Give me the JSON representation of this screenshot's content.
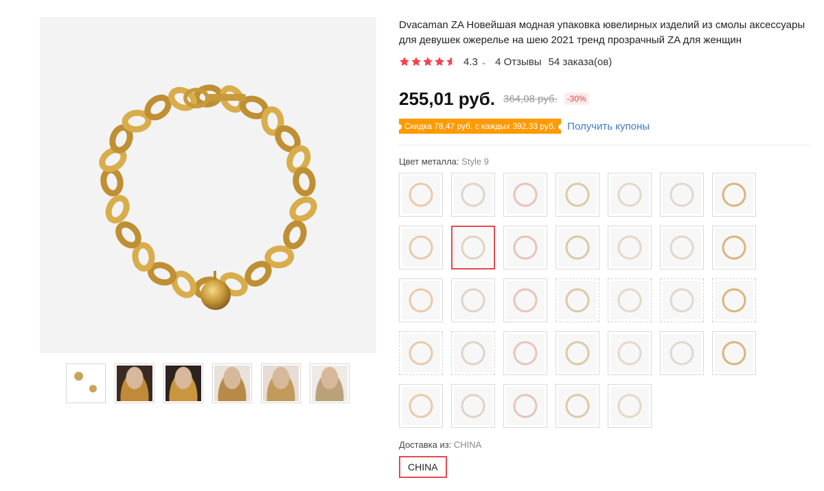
{
  "product": {
    "title": "Dvacaman ZA Новейшая модная упаковка ювелирных изделий из смолы аксессуары для девушек ожерелье на шею 2021 тренд прозрачный ZA для женщин",
    "rating": "4.3",
    "reviews": "4 Отзывы",
    "orders": "54 заказа(ов)",
    "price": "255,01 руб.",
    "old_price": "364,08 руб.",
    "discount": "-30%",
    "coupon_text": "Скидка 78,47 руб. с каждых 392,33 руб.",
    "coupon_link": "Получить купоны"
  },
  "sku": {
    "label": "Цвет металла:",
    "selected": "Style 9",
    "count": 33
  },
  "shipping": {
    "label": "Доставка из:",
    "selected": "CHINA",
    "option": "CHINA"
  },
  "colors": {
    "star": "#f5414e",
    "accent": "#e5484d",
    "coupon": "#ff9a00",
    "link": "#3a7bc8",
    "gold": "#d8a843"
  }
}
